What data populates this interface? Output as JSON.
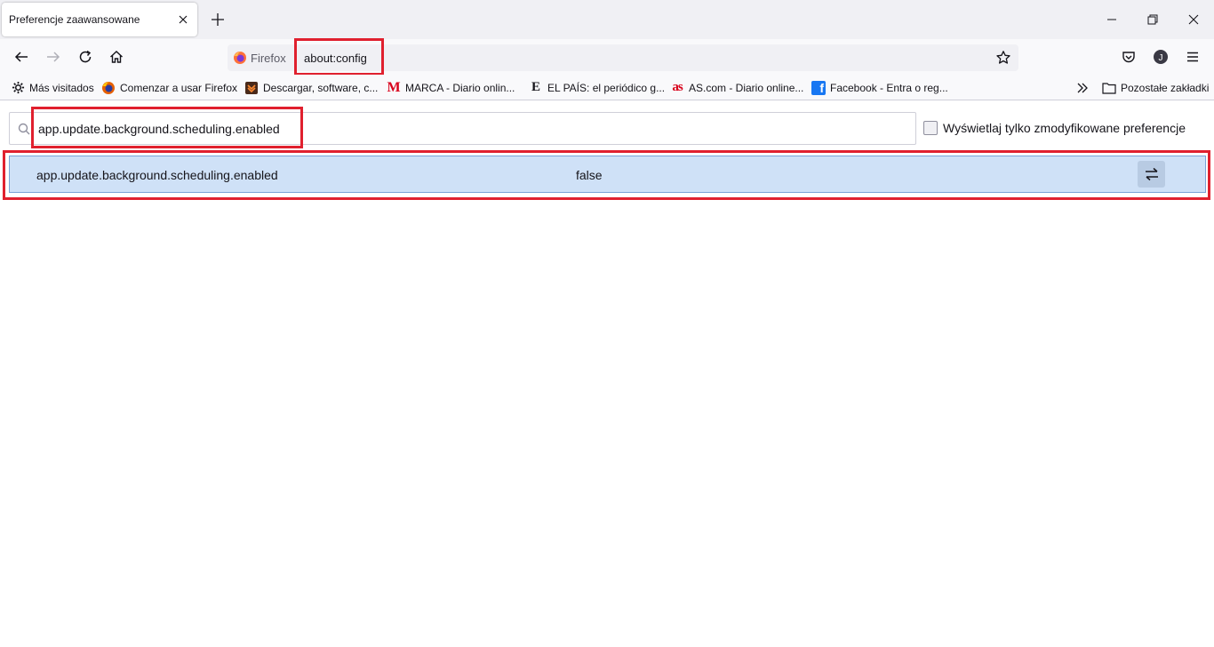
{
  "window": {
    "tab_title": "Preferencje zaawansowane"
  },
  "toolbar": {
    "identity_label": "Firefox",
    "url": "about:config",
    "account_initial": "J"
  },
  "bookmarks": {
    "items": [
      {
        "label": "Más visitados",
        "icon": "gear-icon"
      },
      {
        "label": "Comenzar a usar Firefox",
        "icon": "firefox-icon"
      },
      {
        "label": "Descargar, software, c...",
        "icon": "softonic-icon"
      },
      {
        "label": "MARCA - Diario onlin...",
        "icon": "marca-icon",
        "icon_text": "M"
      },
      {
        "label": "EL PAÍS: el periódico g...",
        "icon": "elpais-icon",
        "icon_text": "E"
      },
      {
        "label": "AS.com - Diario online...",
        "icon": "as-icon",
        "icon_text": "as"
      },
      {
        "label": "Facebook - Entra o reg...",
        "icon": "facebook-icon",
        "icon_text": "f"
      }
    ],
    "other_bookmarks": "Pozostałe zakładki"
  },
  "config": {
    "search_value": "app.update.background.scheduling.enabled",
    "show_modified_label": "Wyświetlaj tylko zmodyfikowane preferencje",
    "show_modified_checked": false,
    "preference": {
      "name": "app.update.background.scheduling.enabled",
      "value": "false"
    }
  },
  "colors": {
    "highlight": "#e0202e",
    "row_selected": "#cfe1f7"
  }
}
